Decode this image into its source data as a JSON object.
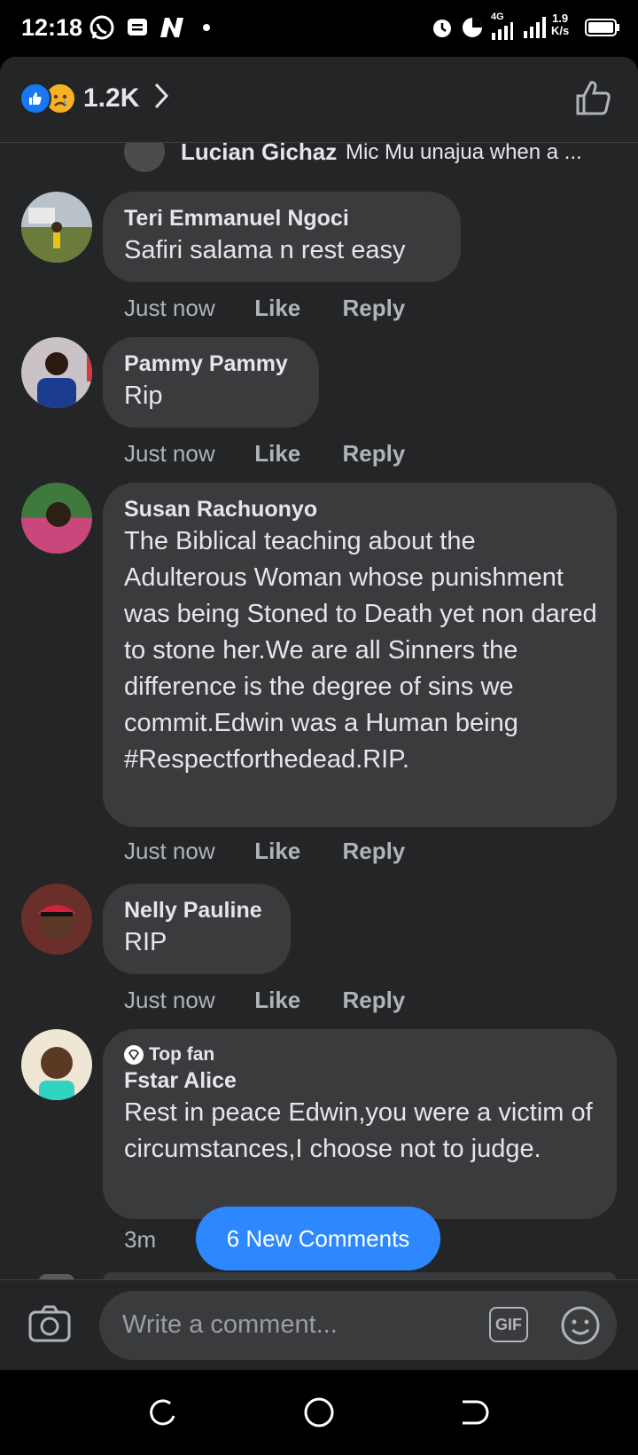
{
  "status_bar": {
    "time": "12:18",
    "network": "4G",
    "speed_value": "1.9",
    "speed_unit": "K/s"
  },
  "header": {
    "reaction_count": "1.2K",
    "reactions": [
      "like-icon",
      "sad-icon"
    ]
  },
  "partial_comment": {
    "name": "Lucian Gichaz",
    "text": "Mic Mu unajua when a ..."
  },
  "comments": [
    {
      "name": "Teri Emmanuel Ngoci",
      "text": "Safiri salama n rest easy",
      "time": "Just now",
      "like": "Like",
      "reply": "Reply"
    },
    {
      "name": "Pammy Pammy",
      "text": "Rip",
      "time": "Just now",
      "like": "Like",
      "reply": "Reply"
    },
    {
      "name": "Susan Rachuonyo",
      "text": "The Biblical teaching about the Adulterous Woman whose punishment was being Stoned to Death yet non dared to stone her.We are all Sinners the difference is the degree of sins we commit.Edwin was a Human being #Respectforthedead.RIP.",
      "time": "Just now",
      "like": "Like",
      "reply": "Reply"
    },
    {
      "name": "Nelly Pauline",
      "text": "RIP",
      "time": "Just now",
      "like": "Like",
      "reply": "Reply"
    },
    {
      "badge": "Top fan",
      "name": "Fstar Alice",
      "text": "Rest in peace Edwin,you were a victim of circumstances,I choose not to judge.",
      "time": "3m"
    }
  ],
  "new_comments_label": "6 New Comments",
  "composer": {
    "placeholder": "Write a comment...",
    "gif_label": "GIF"
  }
}
